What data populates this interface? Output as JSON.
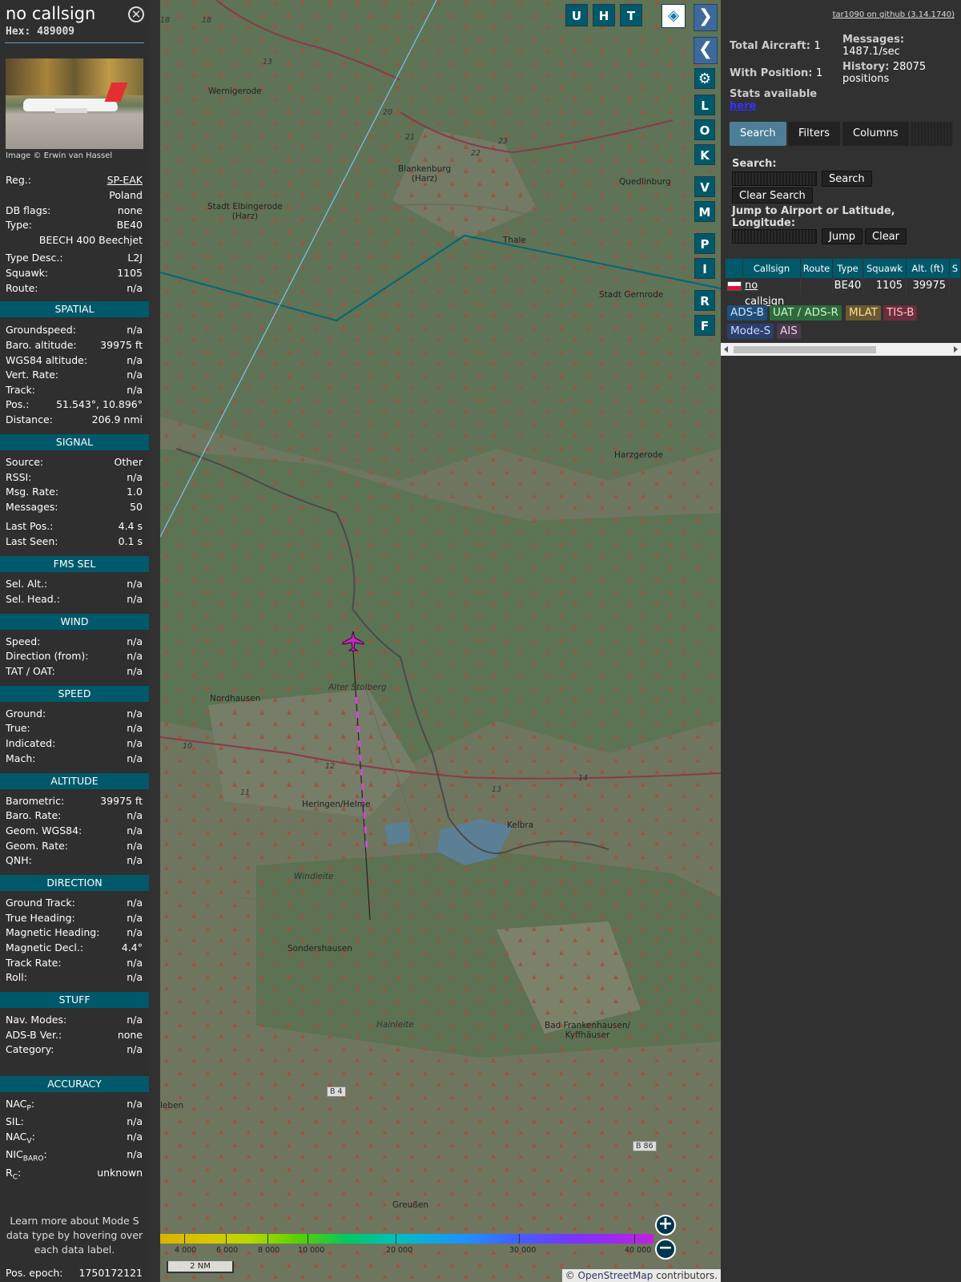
{
  "info": {
    "callsign": "no callsign",
    "hex": "Hex: 489009",
    "photo_credit": "Image © Erwin van Hassel",
    "basic": [
      {
        "label": "Reg.:",
        "value": "SP-EAK"
      },
      {
        "label": "",
        "value": "Poland"
      },
      {
        "label": "DB flags:",
        "value": "none"
      },
      {
        "label": "Type:",
        "value": "BE40"
      },
      {
        "label": "",
        "value": "BEECH 400 Beechjet"
      },
      {
        "label": "Type Desc.:",
        "value": "L2J"
      },
      {
        "label": "Squawk:",
        "value": "1105"
      },
      {
        "label": "Route:",
        "value": "n/a"
      }
    ],
    "sections": {
      "spatial": "SPATIAL",
      "signal": "SIGNAL",
      "fms": "FMS SEL",
      "wind": "WIND",
      "speed": "SPEED",
      "altitude": "ALTITUDE",
      "direction": "DIRECTION",
      "stuff": "STUFF",
      "accuracy": "ACCURACY"
    },
    "spatial": [
      {
        "label": "Groundspeed:",
        "value": "n/a"
      },
      {
        "label": "Baro. altitude:",
        "value": "39975 ft"
      },
      {
        "label": "WGS84 altitude:",
        "value": "n/a"
      },
      {
        "label": "Vert. Rate:",
        "value": "n/a"
      },
      {
        "label": "Track:",
        "value": "n/a"
      },
      {
        "label": "Pos.:",
        "value": "51.543°, 10.896°"
      },
      {
        "label": "Distance:",
        "value": "206.9 nmi"
      }
    ],
    "signal": [
      {
        "label": "Source:",
        "value": "Other"
      },
      {
        "label": "RSSI:",
        "value": "n/a"
      },
      {
        "label": "Msg. Rate:",
        "value": "1.0"
      },
      {
        "label": "Messages:",
        "value": "50"
      },
      {
        "label": "Last Pos.:",
        "value": "4.4 s"
      },
      {
        "label": "Last Seen:",
        "value": "0.1 s"
      }
    ],
    "fms": [
      {
        "label": "Sel. Alt.:",
        "value": "n/a"
      },
      {
        "label": "Sel. Head.:",
        "value": "n/a"
      }
    ],
    "wind": [
      {
        "label": "Speed:",
        "value": "n/a"
      },
      {
        "label": "Direction (from):",
        "value": "n/a"
      },
      {
        "label": "TAT / OAT:",
        "value": "n/a"
      }
    ],
    "speed": [
      {
        "label": "Ground:",
        "value": "n/a"
      },
      {
        "label": "True:",
        "value": "n/a"
      },
      {
        "label": "Indicated:",
        "value": "n/a"
      },
      {
        "label": "Mach:",
        "value": "n/a"
      }
    ],
    "altitude": [
      {
        "label": "Barometric:",
        "value": "39975 ft"
      },
      {
        "label": "Baro. Rate:",
        "value": "n/a"
      },
      {
        "label": "Geom. WGS84:",
        "value": "n/a"
      },
      {
        "label": "Geom. Rate:",
        "value": "n/a"
      },
      {
        "label": "QNH:",
        "value": "n/a"
      }
    ],
    "direction": [
      {
        "label": "Ground Track:",
        "value": "n/a"
      },
      {
        "label": "True Heading:",
        "value": "n/a"
      },
      {
        "label": "Magnetic Heading:",
        "value": "n/a"
      },
      {
        "label": "Magnetic Decl.:",
        "value": "4.4°"
      },
      {
        "label": "Track Rate:",
        "value": "n/a"
      },
      {
        "label": "Roll:",
        "value": "n/a"
      }
    ],
    "stuff": [
      {
        "label": "Nav. Modes:",
        "value": "n/a"
      },
      {
        "label": "ADS-B Ver.:",
        "value": "none"
      },
      {
        "label": "Category:",
        "value": "n/a"
      }
    ],
    "accuracy": [
      {
        "label": "NAC",
        "sub": "P",
        "value": "n/a"
      },
      {
        "label": "SIL:",
        "sub": "",
        "value": "n/a"
      },
      {
        "label": "NAC",
        "sub": "V",
        "value": "n/a"
      },
      {
        "label": "NIC",
        "sub": "BARO",
        "value": "n/a"
      },
      {
        "label": "R",
        "sub": "C",
        "value": "unknown"
      }
    ],
    "note": "Learn more about Mode S data type by hovering over each data label.",
    "epoch_label": "Pos. epoch:",
    "epoch_value": "1750172121"
  },
  "map": {
    "places": [
      {
        "name": "Wernigerode",
        "italic": false
      },
      {
        "name": "Blankenburg\n(Harz)",
        "italic": false
      },
      {
        "name": "Quedlinburg",
        "italic": false
      },
      {
        "name": "Stadt Elbingerode\n(Harz)",
        "italic": false
      },
      {
        "name": "Thale",
        "italic": false
      },
      {
        "name": "Stadt Gernrode",
        "italic": false
      },
      {
        "name": "Harzgerode",
        "italic": false
      },
      {
        "name": "Alter Stolberg",
        "italic": true
      },
      {
        "name": "Nordhausen",
        "italic": false
      },
      {
        "name": "Heringen/Helme",
        "italic": false
      },
      {
        "name": "Kelbra",
        "italic": false
      },
      {
        "name": "Windleite",
        "italic": true
      },
      {
        "name": "Sondershausen",
        "italic": false
      },
      {
        "name": "Bad Frankenhausen/\nKyffhäuser",
        "italic": false
      },
      {
        "name": "Hainleite",
        "italic": true
      },
      {
        "name": "Greußen",
        "italic": false
      },
      {
        "name": "leben",
        "italic": false
      }
    ],
    "road_labels": [
      "18",
      "18",
      "13",
      "20",
      "21",
      "23",
      "22",
      "10",
      "11",
      "12",
      "13",
      "14",
      "B 4",
      "B 86"
    ],
    "top_buttons": [
      "U",
      "H",
      "T"
    ],
    "side_buttons": [
      "L",
      "O",
      "K",
      "V",
      "M",
      "P",
      "I",
      "R",
      "F"
    ],
    "altitude_scale": [
      "4 000",
      "6 000",
      "8 000",
      "10 000",
      "20 000",
      "30 000",
      "40 000"
    ],
    "scale_label": "2 NM",
    "attribution_prefix": "©",
    "attribution_link": "OpenStreetMap",
    "attribution_suffix": "contributors."
  },
  "sidebar": {
    "github": "tar1090 on github (3.14.1740)",
    "total_aircraft_label": "Total Aircraft:",
    "total_aircraft": "1",
    "with_position_label": "With Position:",
    "with_position": "1",
    "messages_label": "Messages:",
    "messages_value": "1487.1/sec",
    "history_label": "History:",
    "history_value": "28075 positions",
    "stats_label": "Stats available",
    "stats_link": "here",
    "tabs": [
      "Search",
      "Filters",
      "Columns"
    ],
    "search_label": "Search:",
    "search_button": "Search",
    "clear_search_button": "Clear Search",
    "jump_label": "Jump to Airport or Latitude, Longitude:",
    "jump_button": "Jump",
    "clear_button": "Clear",
    "table": {
      "headers": [
        "Callsign",
        "Route",
        "Type",
        "Squawk",
        "Alt. (ft)",
        "S"
      ],
      "rows": [
        {
          "callsign": "no callsign",
          "route": "",
          "type": "BE40",
          "squawk": "1105",
          "alt": "39975"
        }
      ]
    },
    "sources": [
      {
        "name": "ADS-B",
        "color": "#1f4e79",
        "text": "#c9e4ff"
      },
      {
        "name": "UAT / ADS-R",
        "color": "#2e6b3a",
        "text": "#c8f5c8"
      },
      {
        "name": "MLAT",
        "color": "#6b5a30",
        "text": "#ffdf9a"
      },
      {
        "name": "TIS-B",
        "color": "#6b2e3a",
        "text": "#ffc0c8"
      },
      {
        "name": "Mode-S",
        "color": "#2b3f6b",
        "text": "#cdd8ff"
      },
      {
        "name": "AIS",
        "color": "#4a3a4a",
        "text": "#f0d0f0"
      }
    ]
  }
}
